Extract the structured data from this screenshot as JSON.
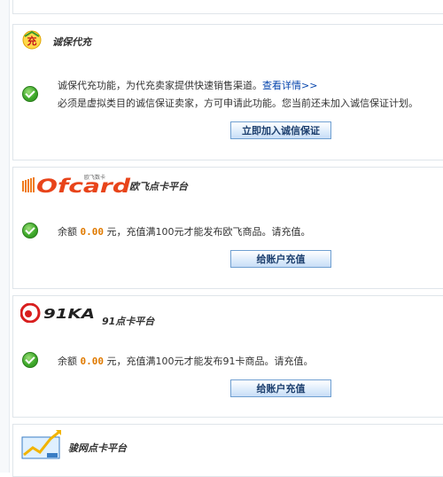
{
  "colors": {
    "accent_link": "#0645ad",
    "amount": "#e07a00",
    "button_border": "#6f9fd1"
  },
  "sections": [
    {
      "title": "诚保代充",
      "logo_icon": "chong-badge-icon",
      "logo_glyph": "充",
      "line1": "诚保代充功能，为代充卖家提供快速销售渠道。",
      "link": "查看详情>>",
      "line2": "必须是虚拟类目的诚信保证卖家，方可申请此功能。您当前还未加入诚信保证计划。",
      "button": "立即加入诚信保证"
    },
    {
      "title": "欧飞点卡平台",
      "logo_text": "Ofcard",
      "logo_sub": "欧飞数卡",
      "balance_prefix": "余额",
      "balance_value": "0.00",
      "balance_suffix": "元，充值满100元才能发布欧飞商品。请充值。",
      "button": "给账户充值"
    },
    {
      "title": "91点卡平台",
      "logo_text": "91KA",
      "balance_prefix": "余额",
      "balance_value": "0.00",
      "balance_suffix": "元，充值满100元才能发布91卡商品。请充值。",
      "button": "给账户充值"
    },
    {
      "title": "骏网点卡平台",
      "logo_icon": "junnet-chart-icon"
    }
  ]
}
